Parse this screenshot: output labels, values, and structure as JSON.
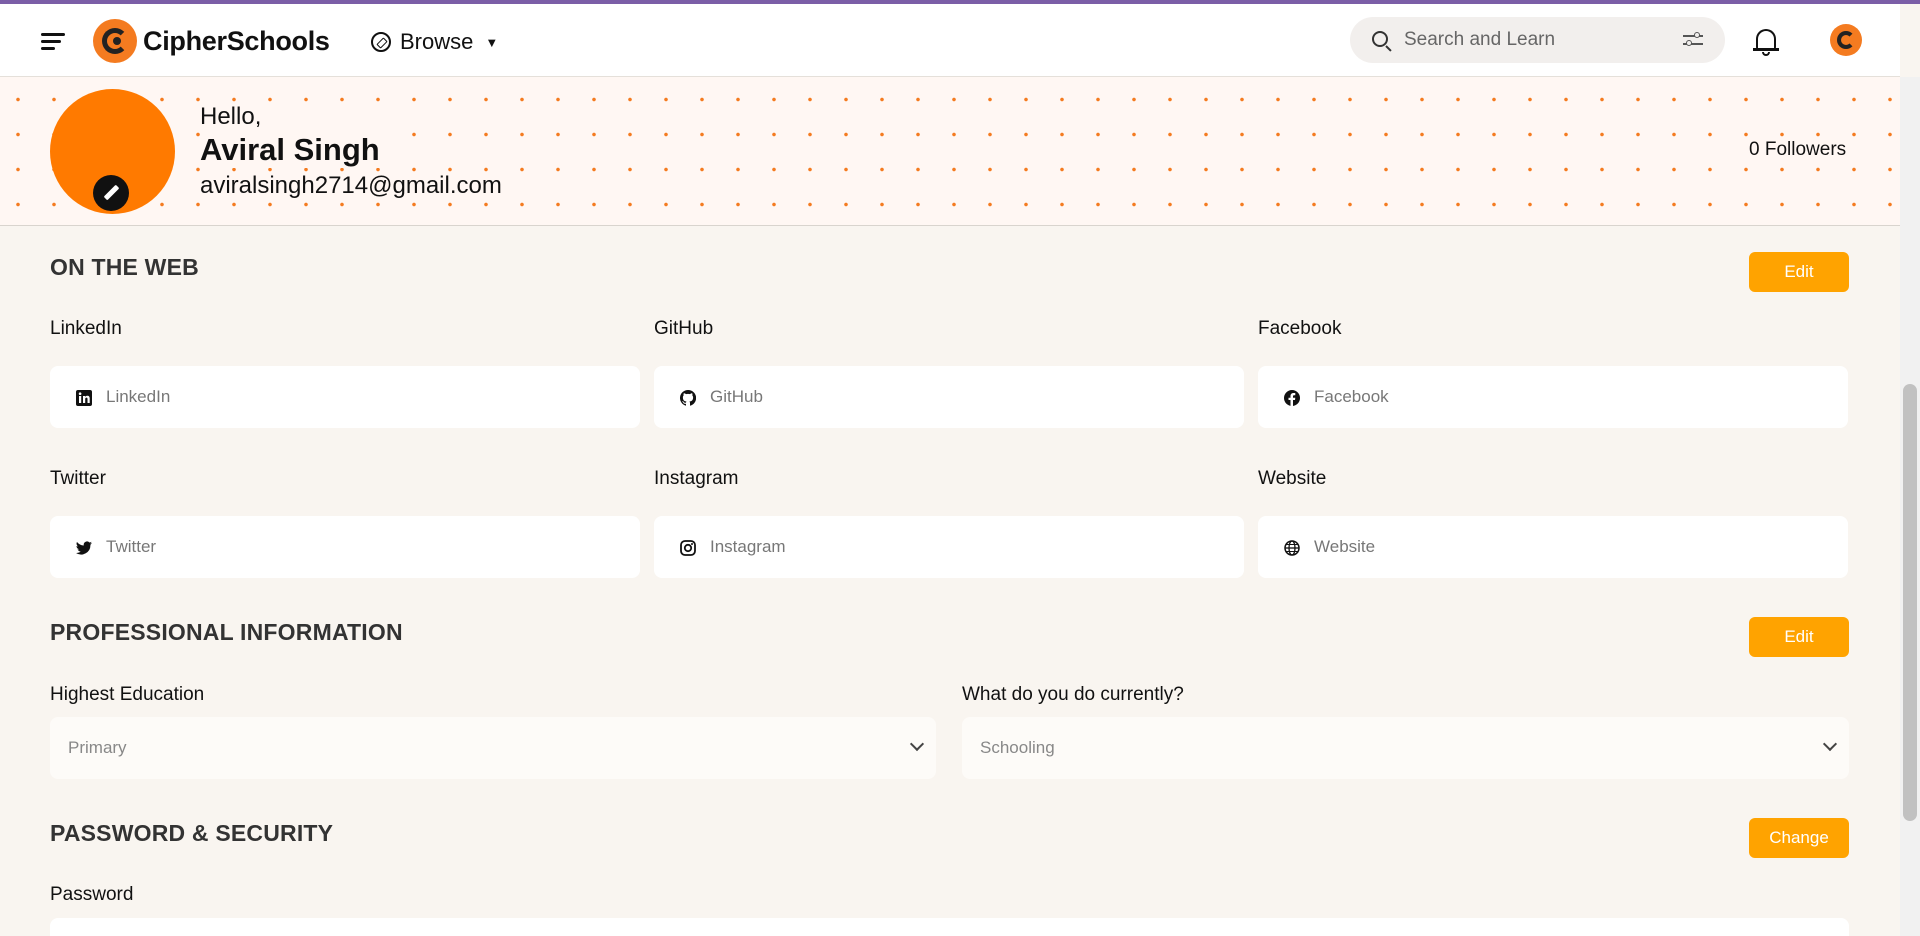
{
  "navbar": {
    "brand": "CipherSchools",
    "browse_label": "Browse",
    "search_placeholder": "Search and Learn"
  },
  "profile": {
    "greeting": "Hello,",
    "name": "Aviral Singh",
    "email": "aviralsingh2714@gmail.com",
    "followers": "0 Followers"
  },
  "on_the_web": {
    "title": "ON THE WEB",
    "edit_label": "Edit",
    "fields": [
      {
        "label": "LinkedIn",
        "placeholder": "LinkedIn",
        "icon": "linkedin-icon"
      },
      {
        "label": "GitHub",
        "placeholder": "GitHub",
        "icon": "github-icon"
      },
      {
        "label": "Facebook",
        "placeholder": "Facebook",
        "icon": "facebook-icon"
      },
      {
        "label": "Twitter",
        "placeholder": "Twitter",
        "icon": "twitter-icon"
      },
      {
        "label": "Instagram",
        "placeholder": "Instagram",
        "icon": "instagram-icon"
      },
      {
        "label": "Website",
        "placeholder": "Website",
        "icon": "globe-icon"
      }
    ]
  },
  "professional": {
    "title": "PROFESSIONAL INFORMATION",
    "edit_label": "Edit",
    "education_label": "Highest Education",
    "education_value": "Primary",
    "current_label": "What do you do currently?",
    "current_value": "Schooling"
  },
  "security": {
    "title": "PASSWORD & SECURITY",
    "change_label": "Change",
    "password_label": "Password"
  },
  "colors": {
    "accent": "#ffa300",
    "brand_orange": "#ff7a00",
    "top_line": "#7b5ea7",
    "page_bg": "#f9f5f0"
  }
}
